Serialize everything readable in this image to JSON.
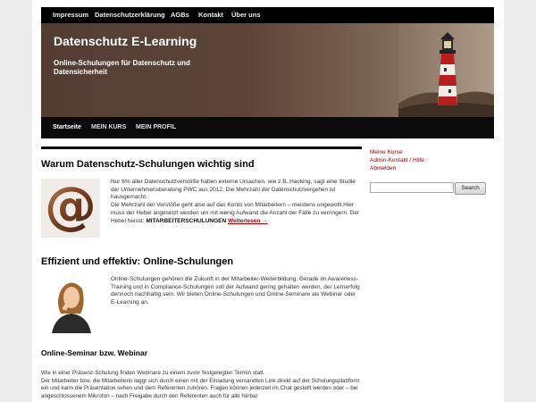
{
  "top_nav": {
    "items": [
      "Impressum",
      "Datenschutzerklärung",
      "AGBs",
      "Kontakt",
      "Über uns"
    ]
  },
  "header": {
    "title": "Datenschutz E-Learning",
    "description": "Online-Schulungen für Datenschutz und Datensicherheit"
  },
  "main_nav": {
    "items": [
      "Startseite",
      "MEIN KURS",
      "MEIN PROFIL"
    ],
    "active": "Startseite"
  },
  "posts": [
    {
      "title": "Warum Datenschutz-Schulungen wichtig sind",
      "image_icon": "at-sign-icon",
      "text_1": "Nur 6% aller Datenschutzverstöße haben externe Ursachen, wie z.B. Hacking, sagt eine Studie der Unternehmensberatung PWC aus 2012. Die Mehrzahl der Datenschutzvergehen ist hausgemacht.",
      "text_2": "Die Mehrzahl der Verstöße geht also auf das Konto von Mitarbeitern – meistens ungewollt.Hier muss der Hebel angesetzt werden um mit wenig Aufwand die Anzahl der Fälle zu verringern. Der Hebel heisst:",
      "emphasis": "MITARBEITERSCHULUNGEN",
      "more_link": "Weiterlesen →"
    },
    {
      "title": "Effizient und effektiv: Online-Schulungen",
      "image_icon": "thinking-woman-photo",
      "text": "Online-Schulungen gehören die Zukunft in der Mitarbeiter-Weiterbildung. Gerade im Awareness-Training und in Compliance-Schulungen soll der Aufwand gering gehalten werden, der Lernerfolg dennoch nachhaltig sein. Wir bieten Online-Schulungen und Online-Seminare als Webinar oder E-Learning an."
    }
  ],
  "section": {
    "title": "Online-Seminar bzw. Webinar",
    "line_1": "Wie in einer Präsenz-Schulung finden Webinare zu einem zuvor festgelegten Termin statt.",
    "line_2": "Der Mitarbeiter bzw. die Mitarbeiterin loggt sich durch einen mit der Einladung versandten Link direkt auf der Schulungsplattform ein und kann die Präsentation sehen und dem Referenten zuhören. Fragen können jederzeit im Chat gestellt werden oder – bei angeschlossenem Mikrofon – nach Freigabe durch den Referenten auch für alle hörbar"
  },
  "sidebar": {
    "links": [
      "Meine Kurse",
      "Admin-Kontakt / Hilfe",
      "Abmelden"
    ],
    "search_value": "",
    "search_button": "Search"
  },
  "colors": {
    "link_red": "#b00000",
    "nav_black": "#000000",
    "header_brown": "#5c4438"
  }
}
